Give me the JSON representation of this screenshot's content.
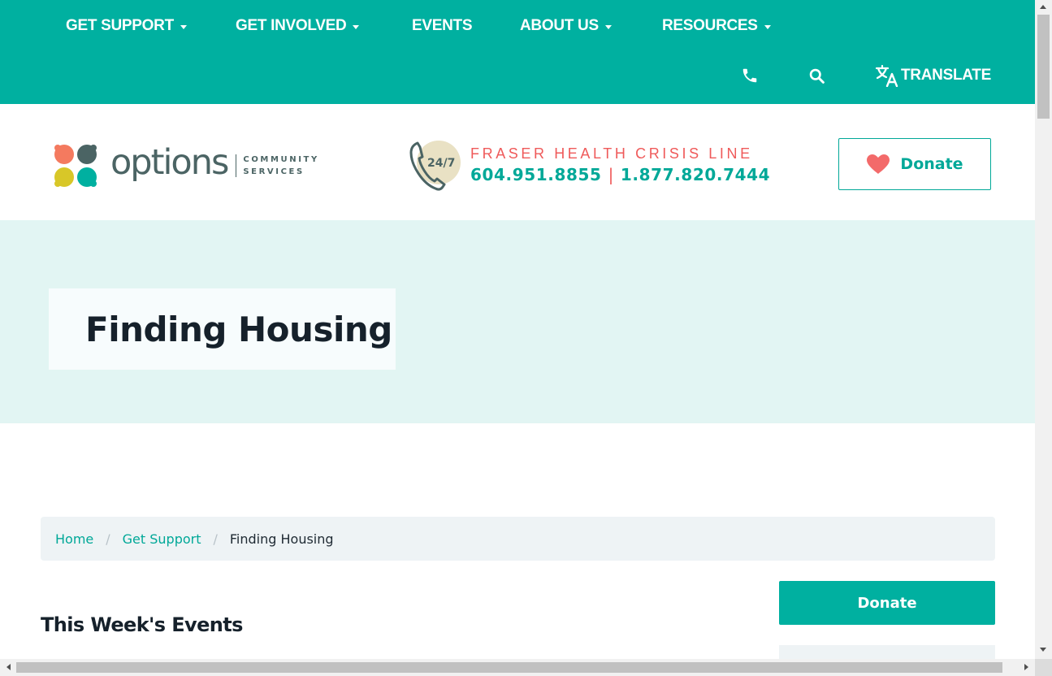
{
  "nav": {
    "items": [
      {
        "label": "GET SUPPORT",
        "has_dropdown": true
      },
      {
        "label": "GET INVOLVED",
        "has_dropdown": true
      },
      {
        "label": "EVENTS",
        "has_dropdown": false
      },
      {
        "label": "ABOUT US",
        "has_dropdown": true
      },
      {
        "label": "RESOURCES",
        "has_dropdown": true
      }
    ],
    "utility": {
      "phone_icon": "phone-icon",
      "search_icon": "search-icon",
      "translate_icon": "translate-icon",
      "translate_label": "TRANSLATE"
    }
  },
  "header": {
    "logo": {
      "wordmark": "options",
      "subline_1": "COMMUNITY",
      "subline_2": "SERVICES"
    },
    "crisis_line": {
      "badge": "24/7",
      "title": "FRASER HEALTH CRISIS LINE",
      "phone_1": "604.951.8855",
      "separator": "|",
      "phone_2": "1.877.820.7444"
    },
    "donate_label": "Donate"
  },
  "hero": {
    "title": "Finding Housing"
  },
  "breadcrumb": {
    "items": [
      "Home",
      "Get Support"
    ],
    "separator": "/",
    "current": "Finding Housing"
  },
  "main": {
    "events_heading": "This Week's Events"
  },
  "sidebar": {
    "donate_label": "Donate"
  },
  "colors": {
    "brand_teal": "#00b0a0",
    "hero_bg": "#e2f5f3",
    "accent_red": "#ef5a5a",
    "logo_gray": "#4b6464"
  }
}
